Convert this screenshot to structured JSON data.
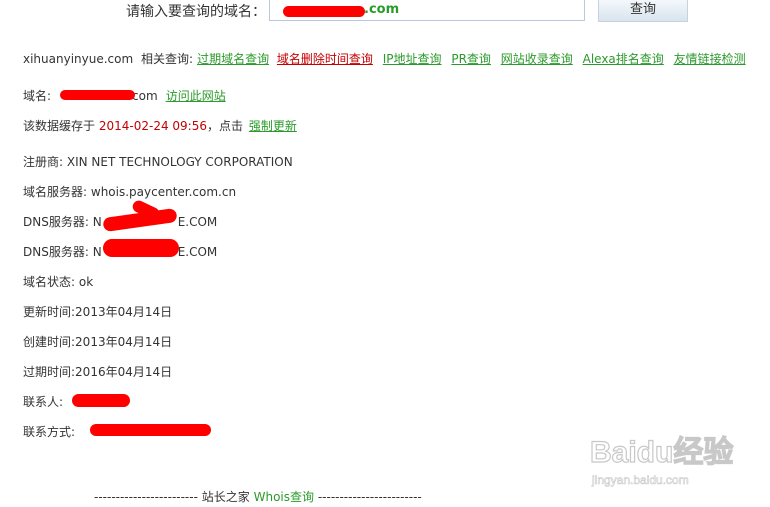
{
  "search": {
    "label": "请输入要查询的域名：",
    "value_visible": ".com",
    "button": "查询"
  },
  "related": {
    "domain": "xihuanyinyue.com",
    "label": "相关查询:",
    "links": [
      "过期域名查询",
      "域名删除时间查询",
      "IP地址查询",
      "PR查询",
      "网站收录查询",
      "Alexa排名查询",
      "友情链接检测"
    ]
  },
  "domain_row": {
    "label": "域名:",
    "suffix": "com",
    "visit_link": "访问此网站"
  },
  "cache_row": {
    "prefix": "该数据缓存于",
    "datetime": "2014-02-24 09:56",
    "middle": "，点击",
    "refresh_link": "强制更新"
  },
  "info": {
    "registrar": {
      "label": "注册商:",
      "value": "XIN NET TECHNOLOGY CORPORATION"
    },
    "whois_server": {
      "label": "域名服务器:",
      "value": "whois.paycenter.com.cn"
    },
    "dns1": {
      "label": "DNS服务器:",
      "prefix": "N",
      "suffix": "E.COM"
    },
    "dns2": {
      "label": "DNS服务器:",
      "prefix": "N",
      "suffix": "E.COM"
    },
    "status": {
      "label": "域名状态:",
      "value": "ok"
    },
    "updated": {
      "label": "更新时间:",
      "value": "2013年04月14日"
    },
    "created": {
      "label": "创建时间:",
      "value": "2013年04月14日"
    },
    "expires": {
      "label": "过期时间:",
      "value": "2016年04月14日"
    },
    "contact": {
      "label": "联系人:"
    },
    "contact_method": {
      "label": "联系方式:"
    }
  },
  "footer": {
    "dashes_left": "------------------------",
    "site": "站长之家",
    "whois": "Whois查询",
    "dashes_right": "------------------------"
  },
  "watermark": {
    "brand": "Baidu经验",
    "url": "jingyan.baidu.com"
  },
  "colors": {
    "link_green": "#2a9a2a",
    "highlight_red": "#c60000",
    "redact_red": "#ff0000"
  }
}
